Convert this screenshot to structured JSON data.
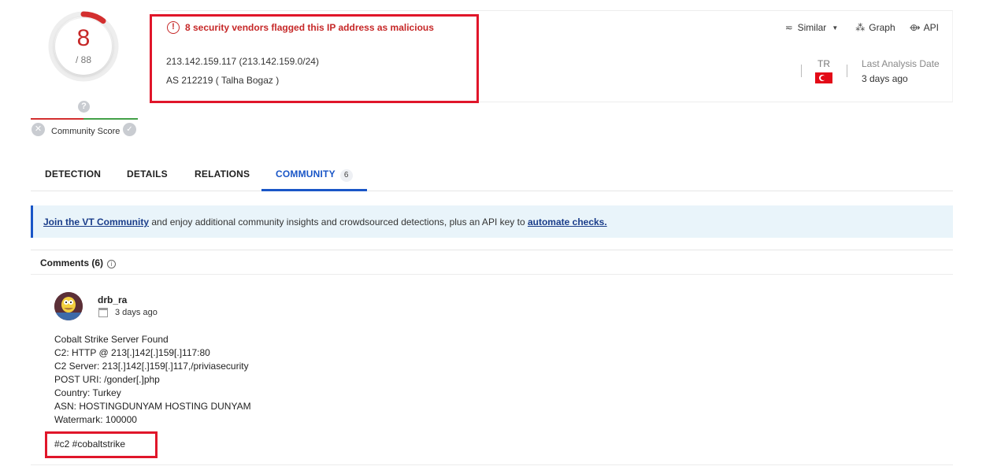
{
  "score": {
    "detections": "8",
    "total": "/ 88"
  },
  "community_score": {
    "label": "Community Score",
    "question_mark": "?"
  },
  "alert": {
    "text": "8 security vendors flagged this IP address as malicious"
  },
  "ip": {
    "line": "213.142.159.117  (213.142.159.0/24)",
    "as_line": "AS 212219  ( Talha Bogaz )"
  },
  "actions": {
    "similar": "Similar",
    "graph": "Graph",
    "api": "API"
  },
  "country": {
    "code": "TR"
  },
  "last_analysis": {
    "label": "Last Analysis Date",
    "value": "3 days ago"
  },
  "tabs": [
    {
      "label": "DETECTION"
    },
    {
      "label": "DETAILS"
    },
    {
      "label": "RELATIONS"
    },
    {
      "label": "COMMUNITY",
      "badge": "6"
    }
  ],
  "banner": {
    "link1": "Join the VT Community",
    "middle": " and enjoy additional community insights and crowdsourced detections, plus an API key to ",
    "link2": "automate checks."
  },
  "comments": {
    "heading": "Comments  (6)",
    "items": [
      {
        "user": "drb_ra",
        "posted": "3 days ago",
        "lines": [
          "Cobalt Strike Server Found",
          "C2: HTTP @ 213[.]142[.]159[.]117:80",
          "C2 Server: 213[.]142[.]159[.]117,/priviasecurity",
          "POST URI: /gonder[.]php",
          "Country: Turkey",
          "ASN: HOSTINGDUNYAM HOSTING DUNYAM",
          "Watermark: 100000"
        ],
        "tags": "#c2 #cobaltstrike"
      }
    ]
  },
  "colors": {
    "malicious": "#c62828",
    "accent": "#1a56c7",
    "highlight": "#e0162a"
  }
}
